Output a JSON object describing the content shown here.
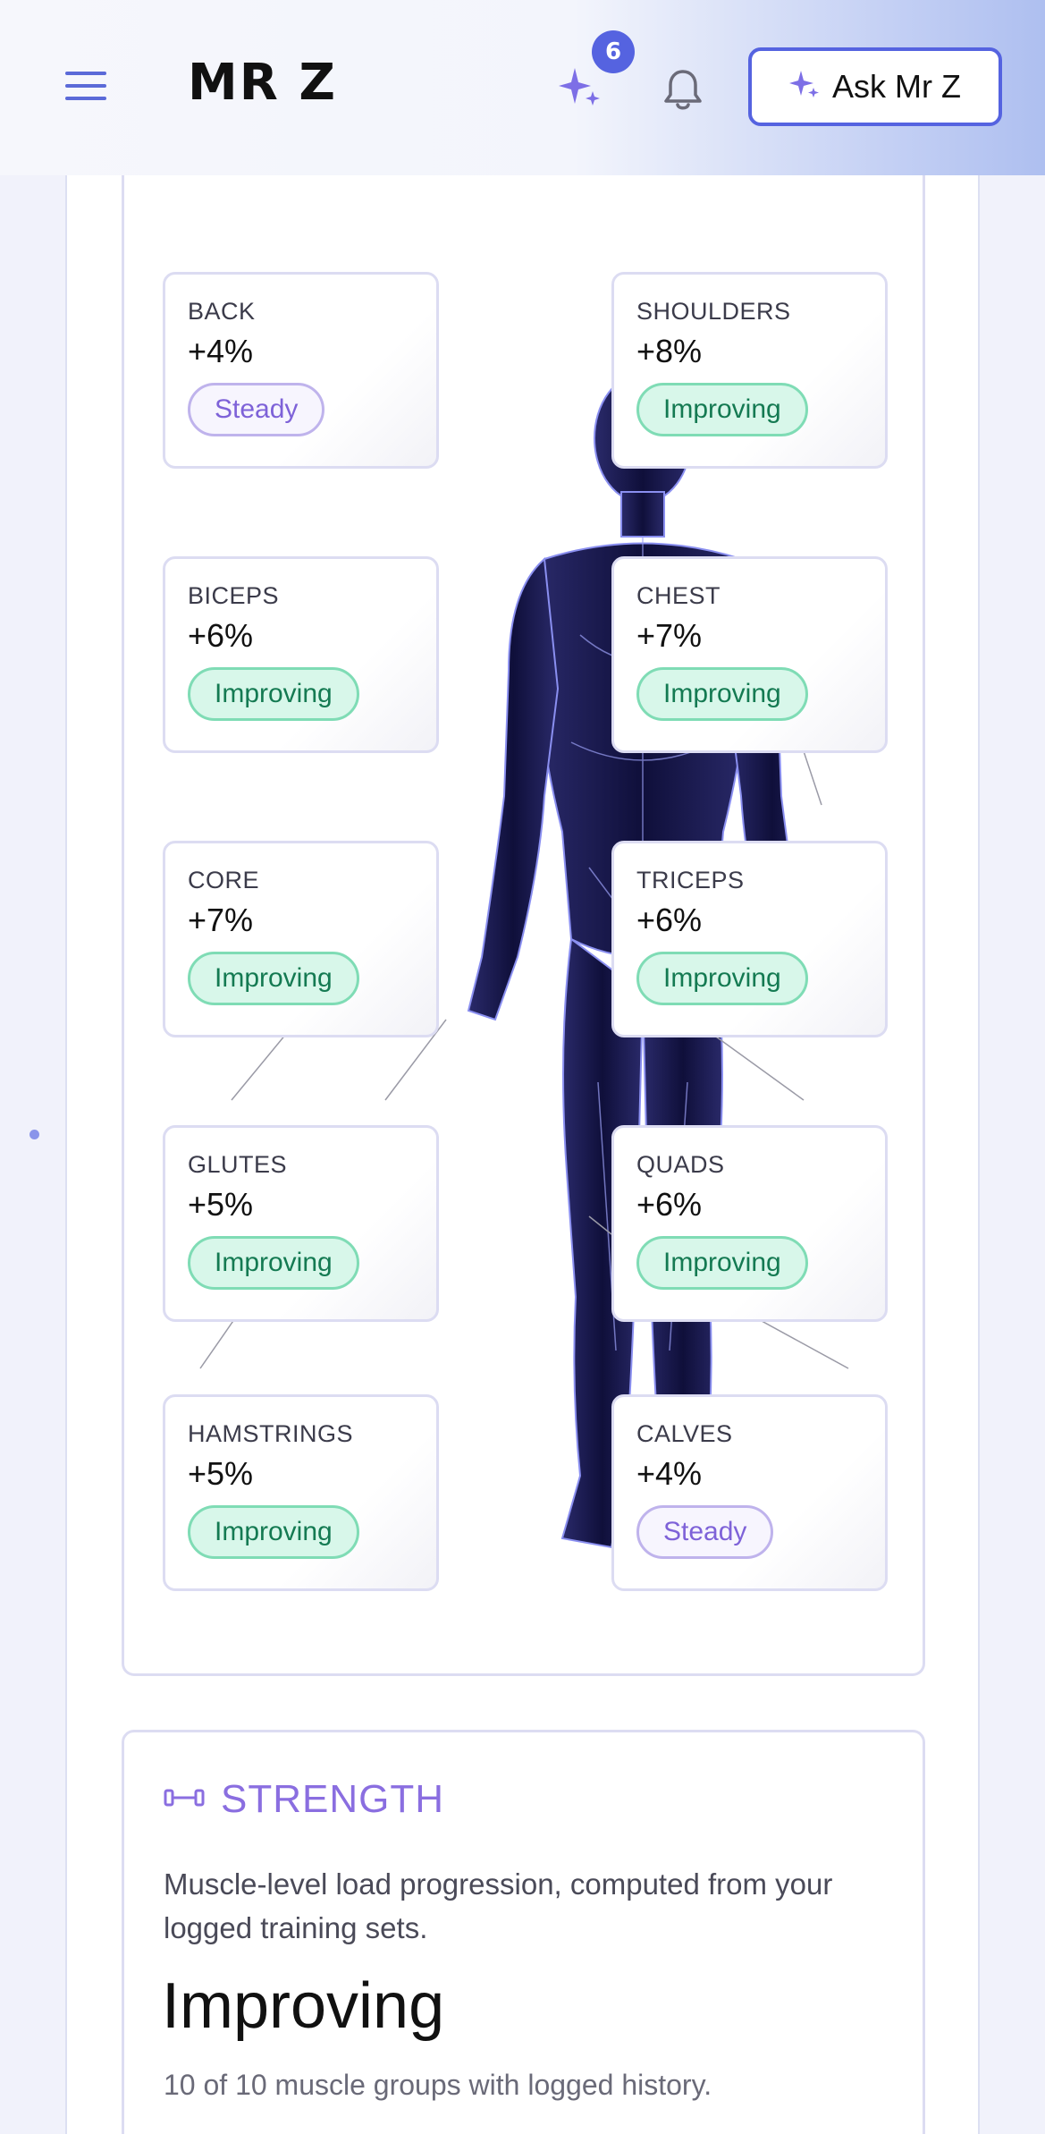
{
  "header": {
    "logo_text": "MR Z",
    "notification_count": "6",
    "ask_button_label": "Ask Mr Z"
  },
  "muscles": [
    {
      "name": "BACK",
      "change": "+4%",
      "status": "Steady"
    },
    {
      "name": "SHOULDERS",
      "change": "+8%",
      "status": "Improving"
    },
    {
      "name": "BICEPS",
      "change": "+6%",
      "status": "Improving"
    },
    {
      "name": "CHEST",
      "change": "+7%",
      "status": "Improving"
    },
    {
      "name": "CORE",
      "change": "+7%",
      "status": "Improving"
    },
    {
      "name": "TRICEPS",
      "change": "+6%",
      "status": "Improving"
    },
    {
      "name": "GLUTES",
      "change": "+5%",
      "status": "Improving"
    },
    {
      "name": "QUADS",
      "change": "+6%",
      "status": "Improving"
    },
    {
      "name": "HAMSTRINGS",
      "change": "+5%",
      "status": "Improving"
    },
    {
      "name": "CALVES",
      "change": "+4%",
      "status": "Steady"
    }
  ],
  "strength": {
    "title": "STRENGTH",
    "description": "Muscle-level load progression, computed from your logged training sets.",
    "status": "Improving",
    "summary": "10 of 10 muscle groups with logged history."
  },
  "icons": {
    "menu": "hamburger-menu-icon",
    "sparkle": "sparkle-icon",
    "bell": "bell-icon",
    "dumbbell": "dumbbell-icon"
  },
  "colors": {
    "accent": "#5563e0",
    "improving_bg": "#d8f7ea",
    "improving_text": "#147a52",
    "steady_text": "#7e62d8",
    "strength_title": "#8a6ee0"
  }
}
